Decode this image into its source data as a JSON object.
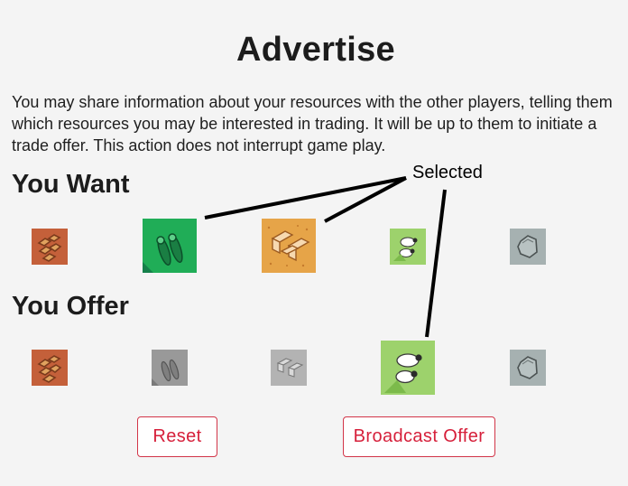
{
  "page": {
    "title": "Advertise",
    "description": "You may share information about your resources with the other players, telling them which resources you may be interested in trading. It will be up to them to initiate a trade offer. This action does not interrupt game play."
  },
  "want": {
    "heading": "You Want",
    "resources": [
      {
        "name": "brick",
        "icon": "brick-icon",
        "selected": false
      },
      {
        "name": "wood",
        "icon": "wood-icon",
        "selected": true
      },
      {
        "name": "grain",
        "icon": "wheat-icon",
        "selected": true
      },
      {
        "name": "sheep",
        "icon": "sheep-icon",
        "selected": false
      },
      {
        "name": "ore",
        "icon": "stone-icon",
        "selected": false
      }
    ]
  },
  "offer": {
    "heading": "You Offer",
    "resources": [
      {
        "name": "brick",
        "icon": "brick-icon",
        "selected": false,
        "state": "enabled"
      },
      {
        "name": "wood",
        "icon": "wood-icon",
        "selected": false,
        "state": "disabled"
      },
      {
        "name": "grain",
        "icon": "wheat-icon",
        "selected": false,
        "state": "disabled"
      },
      {
        "name": "sheep",
        "icon": "sheep-icon",
        "selected": true,
        "state": "enabled"
      },
      {
        "name": "ore",
        "icon": "stone-icon",
        "selected": false,
        "state": "enabled"
      }
    ]
  },
  "buttons": {
    "reset": "Reset",
    "broadcast": "Broadcast Offer"
  },
  "annotation": {
    "label": "Selected"
  },
  "colors": {
    "background": "#f4f4f4",
    "accent": "#d61f3a",
    "brick": "#c4603a",
    "wood": "#20ad57",
    "grain": "#e6a448",
    "sheep": "#9dd26c",
    "ore": "#a6b1b1",
    "disabled": "#999999"
  }
}
